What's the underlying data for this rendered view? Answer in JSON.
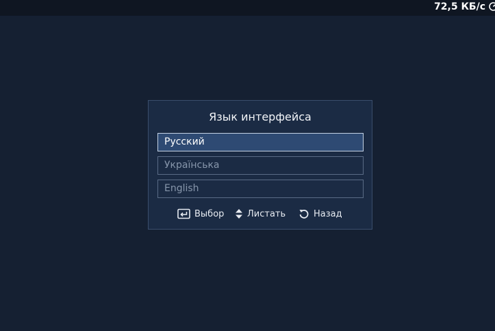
{
  "status_bar": {
    "speed": "72,5 КБ/с",
    "speed_icon": "speedometer-icon"
  },
  "dialog": {
    "title": "Язык интерфейса",
    "options": [
      {
        "label": "Русский",
        "selected": true
      },
      {
        "label": "Українська",
        "selected": false
      },
      {
        "label": "English",
        "selected": false
      }
    ],
    "hints": [
      {
        "icon": "enter-icon",
        "label": "Выбор"
      },
      {
        "icon": "up-down-arrows-icon",
        "label": "Листать"
      },
      {
        "icon": "back-arrow-icon",
        "label": "Назад"
      }
    ]
  },
  "colors": {
    "background": "#152032",
    "dialog_background": "#1b2b44",
    "selected_background": "#2e4a73",
    "text": "#ffffff"
  }
}
